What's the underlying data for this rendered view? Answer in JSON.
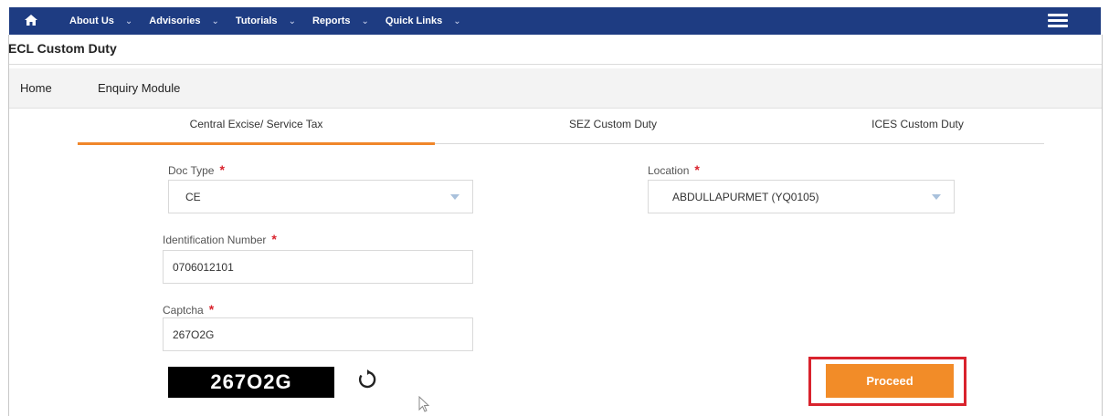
{
  "nav": {
    "home_icon": "home-icon",
    "items": [
      {
        "label": "About Us"
      },
      {
        "label": "Advisories"
      },
      {
        "label": "Tutorials"
      },
      {
        "label": "Reports"
      },
      {
        "label": "Quick Links"
      }
    ],
    "chevron": "⌄",
    "menu_icon": "hamburger-menu-icon",
    "bar_color": "#1e3c82"
  },
  "page": {
    "title": "ECL Custom Duty"
  },
  "breadcrumb": {
    "home": "Home",
    "module": "Enquiry Module"
  },
  "tabs": [
    {
      "label": "Central Excise/ Service Tax",
      "active": true
    },
    {
      "label": "SEZ Custom Duty",
      "active": false
    },
    {
      "label": "ICES Custom Duty",
      "active": false
    }
  ],
  "form": {
    "doc_type": {
      "label": "Doc Type",
      "required": "*",
      "value": "CE"
    },
    "location": {
      "label": "Location",
      "required": "*",
      "value": "ABDULLAPURMET (YQ0105)"
    },
    "identification_number": {
      "label": "Identification Number",
      "required": "*",
      "value": "0706012101"
    },
    "captcha": {
      "label": "Captcha",
      "required": "*",
      "value": "267O2G",
      "image_text": "267O2G"
    },
    "refresh_icon": "refresh-icon",
    "proceed_label": "Proceed"
  },
  "colors": {
    "accent": "#f28c28",
    "highlight_frame": "#d9232d",
    "required_star": "#d9232d"
  }
}
